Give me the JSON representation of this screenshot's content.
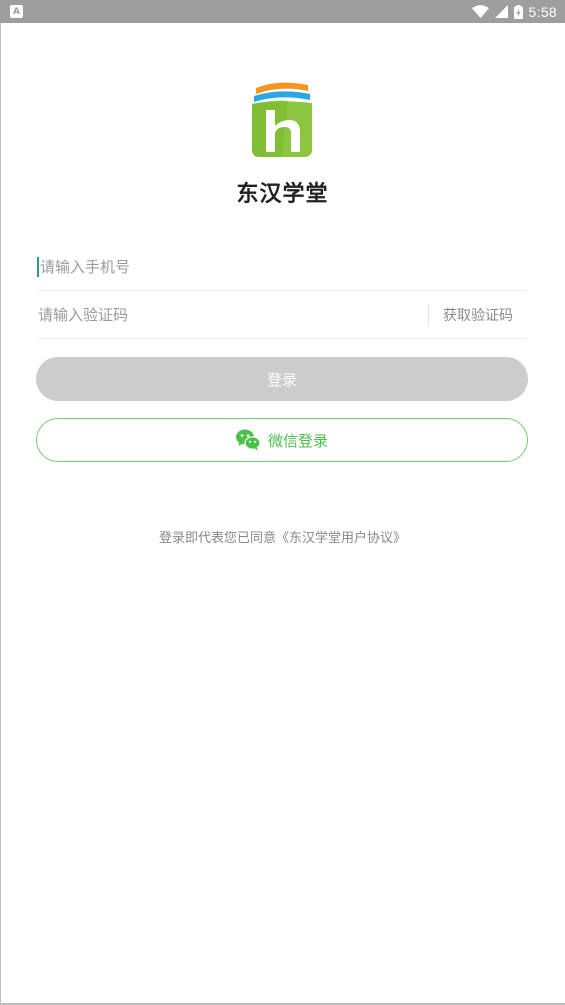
{
  "status_bar": {
    "time": "5:58",
    "notification_letter": "A",
    "icons": [
      "notification-icon",
      "wifi-icon",
      "signal-icon",
      "battery-icon"
    ]
  },
  "brand": {
    "name": "东汉学堂",
    "logo_letter": "h",
    "colors": {
      "green": "#8cc63f",
      "blue": "#29a9e1",
      "orange": "#f7941d"
    }
  },
  "form": {
    "phone_placeholder": "请输入手机号",
    "code_placeholder": "请输入验证码",
    "get_code_label": "获取验证码"
  },
  "buttons": {
    "login_label": "登录",
    "wechat_label": "微信登录",
    "wechat_icon": "wechat-icon"
  },
  "agreement": {
    "prefix": "登录即代表您已同意",
    "link": "《东汉学堂用户协议》"
  },
  "colors": {
    "accent_green": "#4cbf4c",
    "disabled_gray": "#cccccc"
  }
}
